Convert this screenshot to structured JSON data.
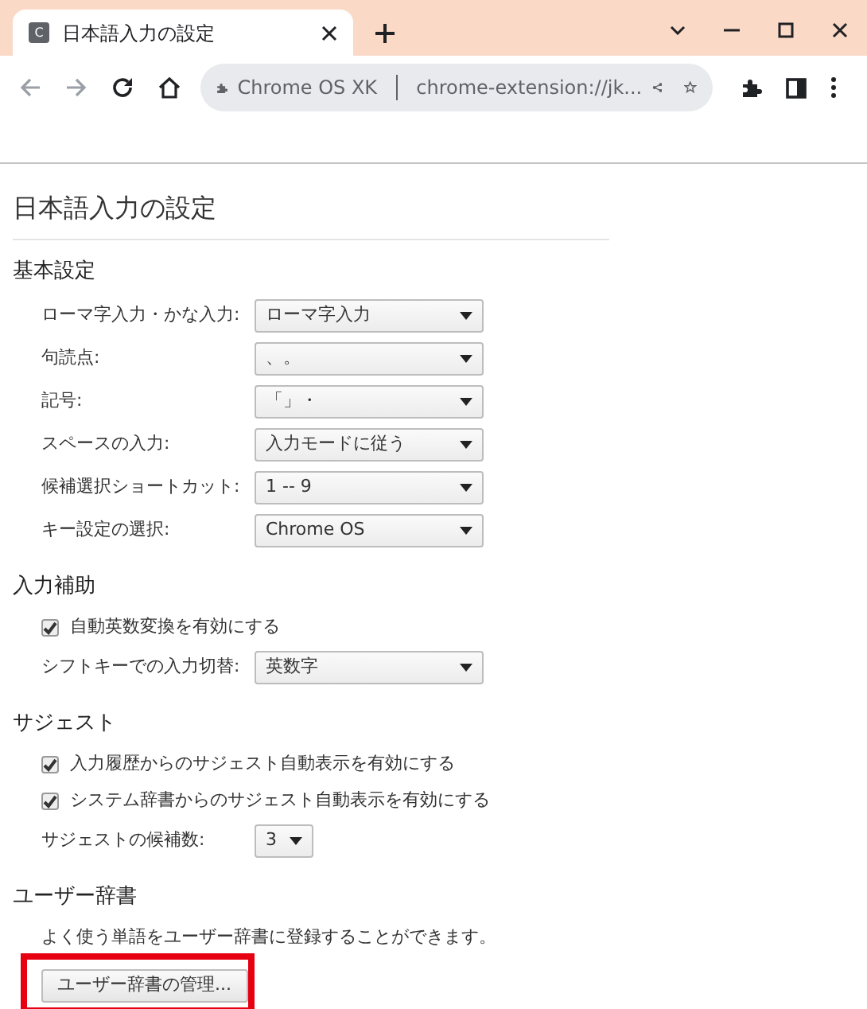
{
  "browser": {
    "tab": {
      "favicon": "C",
      "title": "日本語入力の設定"
    },
    "address_bar": {
      "site_name": "Chrome OS XK",
      "url": "chrome-extension://jk..."
    }
  },
  "page_title": "日本語入力の設定",
  "sections": [
    {
      "title": "基本設定",
      "items": [
        {
          "kind": "select",
          "label": "ローマ字入力・かな入力:",
          "value": "ローマ字入力"
        },
        {
          "kind": "select",
          "label": "句読点:",
          "value": "、。"
        },
        {
          "kind": "select",
          "label": "記号:",
          "value": "「」・"
        },
        {
          "kind": "select",
          "label": "スペースの入力:",
          "value": "入力モードに従う"
        },
        {
          "kind": "select",
          "label": "候補選択ショートカット:",
          "value": "1 -- 9"
        },
        {
          "kind": "select",
          "label": "キー設定の選択:",
          "value": "Chrome OS"
        }
      ]
    },
    {
      "title": "入力補助",
      "items": [
        {
          "kind": "checkbox",
          "label": "自動英数変換を有効にする",
          "checked": true
        },
        {
          "kind": "select",
          "label": "シフトキーでの入力切替:",
          "value": "英数字"
        }
      ]
    },
    {
      "title": "サジェスト",
      "items": [
        {
          "kind": "checkbox",
          "label": "入力履歴からのサジェスト自動表示を有効にする",
          "checked": true
        },
        {
          "kind": "checkbox",
          "label": "システム辞書からのサジェスト自動表示を有効にする",
          "checked": true
        },
        {
          "kind": "small_select",
          "label": "サジェストの候補数:",
          "value": "3"
        }
      ]
    },
    {
      "title": "ユーザー辞書",
      "items": [
        {
          "kind": "text",
          "label": "よく使う単語をユーザー辞書に登録することができます。"
        },
        {
          "kind": "button",
          "label": "ユーザー辞書の管理..."
        }
      ]
    }
  ]
}
